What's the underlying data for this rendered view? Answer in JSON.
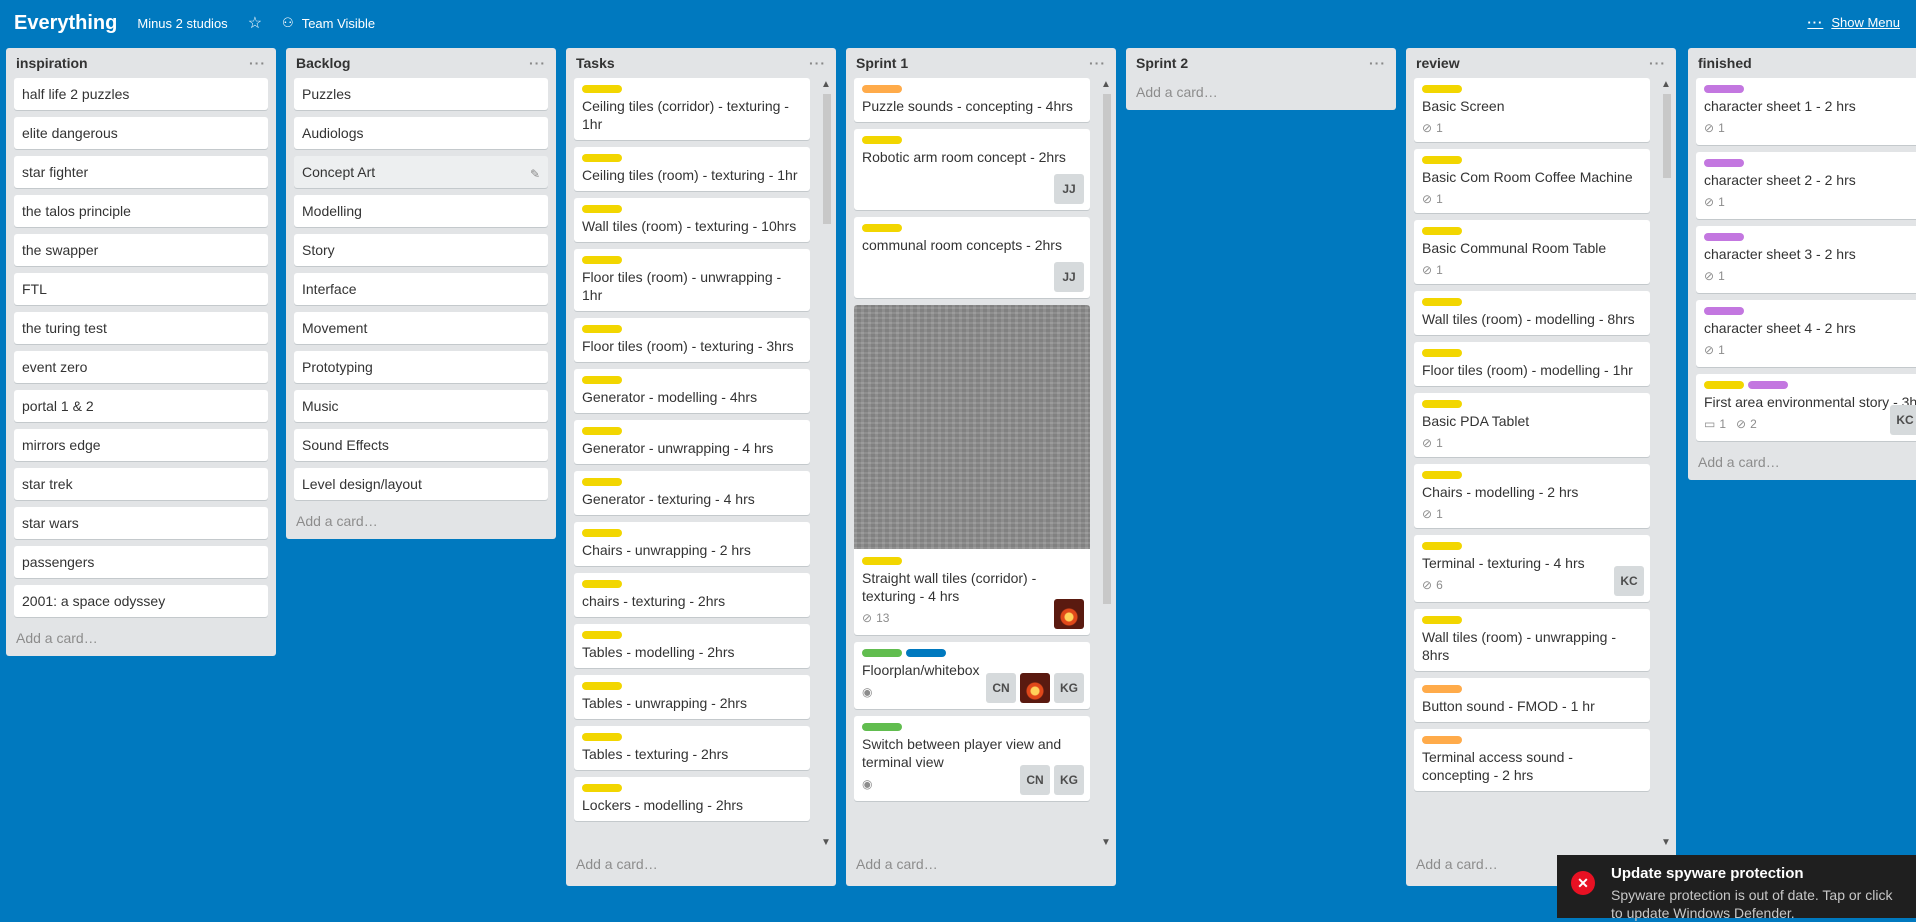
{
  "header": {
    "board_title": "Everything",
    "team": "Minus 2 studios",
    "visibility": "Team Visible",
    "show_menu": "Show Menu",
    "icons": {
      "star": "star-icon",
      "visibility": "team-visibility-icon",
      "menu": "ellipsis-icon"
    }
  },
  "common": {
    "add_card": "Add a card…",
    "list_menu": "···"
  },
  "lists": {
    "inspiration": {
      "title": "inspiration",
      "cards": [
        "half life 2 puzzles",
        "elite dangerous",
        "star fighter",
        "the talos principle",
        "the swapper",
        "FTL",
        "the turing test",
        "event zero",
        "portal 1 & 2",
        "mirrors edge",
        "star trek",
        "star wars",
        "passengers",
        "2001: a space odyssey"
      ]
    },
    "backlog": {
      "title": "Backlog",
      "cards": [
        "Puzzles",
        "Audiologs",
        "Concept Art",
        "Modelling",
        "Story",
        "Interface",
        "Movement",
        "Prototyping",
        "Music",
        "Sound Effects",
        "Level design/layout"
      ]
    },
    "tasks": {
      "title": "Tasks",
      "cards": [
        "Ceiling tiles (corridor) - texturing - 1hr",
        "Ceiling tiles (room) - texturing - 1hr",
        "Wall tiles (room) - texturing - 10hrs",
        "Floor tiles (room) - unwrapping - 1hr",
        "Floor tiles (room) - texturing - 3hrs",
        "Generator - modelling - 4hrs",
        "Generator - unwrapping - 4 hrs",
        "Generator - texturing - 4 hrs",
        "Chairs - unwrapping - 2 hrs",
        "chairs - texturing - 2hrs",
        "Tables - modelling - 2hrs",
        "Tables - unwrapping - 2hrs",
        "Tables - texturing - 2hrs",
        "Lockers - modelling - 2hrs"
      ]
    },
    "sprint1": {
      "title": "Sprint 1",
      "cards": {
        "c1": {
          "title": "Puzzle sounds - concepting - 4hrs"
        },
        "c2": {
          "title": "Robotic arm room concept - 2hrs",
          "member": "JJ"
        },
        "c3": {
          "title": "communal room concepts - 2hrs",
          "member": "JJ"
        },
        "c4": {
          "title": "Straight wall tiles (corridor) - texturing - 4 hrs",
          "attachments": "13"
        },
        "c5": {
          "title": "Floorplan/whitebox",
          "members": [
            "CN",
            "KG"
          ]
        },
        "c6": {
          "title": "Switch between player view and terminal view",
          "members": [
            "CN",
            "KG"
          ]
        }
      }
    },
    "sprint2": {
      "title": "Sprint 2"
    },
    "review": {
      "title": "review",
      "cards": {
        "c1": {
          "title": "Basic Screen",
          "attachments": "1"
        },
        "c2": {
          "title": "Basic Com Room Coffee Machine",
          "attachments": "1"
        },
        "c3": {
          "title": "Basic Communal Room Table",
          "attachments": "1"
        },
        "c4": {
          "title": "Wall tiles (room) - modelling - 8hrs"
        },
        "c5": {
          "title": "Floor tiles (room) - modelling - 1hr"
        },
        "c6": {
          "title": "Basic PDA Tablet",
          "attachments": "1"
        },
        "c7": {
          "title": "Chairs - modelling - 2 hrs",
          "attachments": "1"
        },
        "c8": {
          "title": "Terminal - texturing - 4 hrs",
          "attachments": "6",
          "member": "KC"
        },
        "c9": {
          "title": "Wall tiles (room) - unwrapping - 8hrs"
        },
        "c10": {
          "title": "Button sound - FMOD - 1 hr"
        },
        "c11": {
          "title": "Terminal access sound - concepting - 2 hrs"
        }
      }
    },
    "finished": {
      "title": "finished",
      "cards": {
        "c1": {
          "title": "character sheet 1 - 2 hrs",
          "attachments": "1"
        },
        "c2": {
          "title": "character sheet 2 - 2 hrs",
          "attachments": "1"
        },
        "c3": {
          "title": "character sheet 3 - 2 hrs",
          "attachments": "1"
        },
        "c4": {
          "title": "character sheet 4 - 2 hrs",
          "attachments": "1"
        },
        "c5": {
          "title": "First area environmental story - 3h",
          "comments": "1",
          "attachments": "2",
          "member": "KC"
        }
      }
    }
  },
  "toast": {
    "title": "Update spyware protection",
    "body": "Spyware protection is out of date. Tap or click to update Windows Defender."
  },
  "label_colors": {
    "yellow": "#f2d600",
    "orange": "#ffab4a",
    "green": "#61bd4f",
    "blue": "#0079bf",
    "purple": "#c377e0"
  },
  "board_background": "#0079bf"
}
